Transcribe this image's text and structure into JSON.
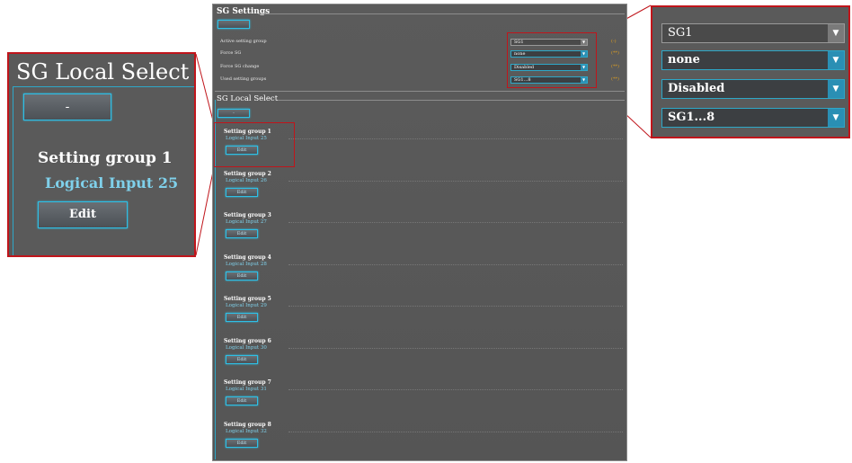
{
  "sg_settings": {
    "title": "SG Settings",
    "top_button_label": "",
    "rows": [
      {
        "label": "Active setting group",
        "value": "SG1",
        "hint": "(-)"
      },
      {
        "label": "Force SG",
        "value": "none",
        "hint": "(**)"
      },
      {
        "label": "Force SG change",
        "value": "Disabled",
        "hint": "(**)"
      },
      {
        "label": "Used setting groups",
        "value": "SG1...8",
        "hint": "(**)"
      }
    ]
  },
  "sg_local_select": {
    "title": "SG Local Select",
    "minus_label": "-",
    "edit_label": "Edit",
    "groups": [
      {
        "title": "Setting group 1",
        "input": "Logical Input 25"
      },
      {
        "title": "Setting group 2",
        "input": "Logical Input 26"
      },
      {
        "title": "Setting group 3",
        "input": "Logical Input 27"
      },
      {
        "title": "Setting group 4",
        "input": "Logical Input 28"
      },
      {
        "title": "Setting group 5",
        "input": "Logical Input 29"
      },
      {
        "title": "Setting group 6",
        "input": "Logical Input 30"
      },
      {
        "title": "Setting group 7",
        "input": "Logical Input 31"
      },
      {
        "title": "Setting group 8",
        "input": "Logical Input 32"
      }
    ]
  },
  "zoom_left": {
    "title": "SG Local Select",
    "minus_label": "-",
    "group_title": "Setting group 1",
    "group_input": "Logical Input 25",
    "edit_label": "Edit"
  },
  "zoom_right": {
    "values": [
      "SG1",
      "none",
      "Disabled",
      "SG1...8"
    ]
  },
  "colors": {
    "panel_bg": "#585858",
    "accent": "#2ec0e6",
    "callout": "#c0151b",
    "hint": "#e0a020"
  }
}
